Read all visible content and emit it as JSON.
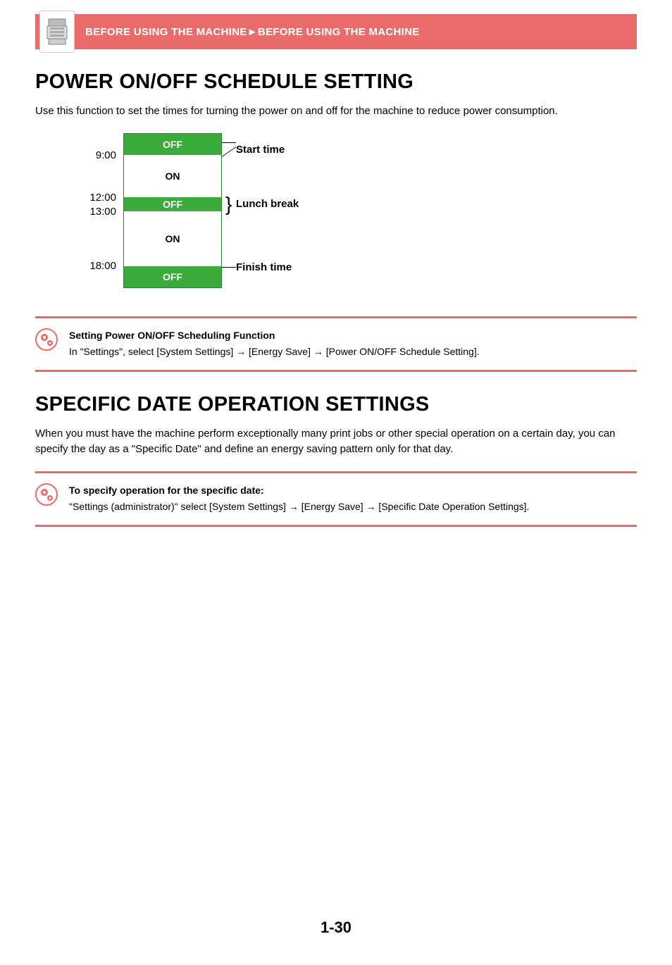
{
  "header": {
    "breadcrumb": "BEFORE USING THE MACHINE►BEFORE USING THE MACHINE"
  },
  "section1": {
    "title": "POWER ON/OFF SCHEDULE SETTING",
    "intro": "Use this function to set the times for turning the power on and off for the machine to reduce power consumption."
  },
  "diagram": {
    "times": {
      "t1": "9:00",
      "t2": "12:00",
      "t3": "13:00",
      "t4": "18:00"
    },
    "segs": {
      "off1": "OFF",
      "on1": "ON",
      "off2": "OFF",
      "on2": "ON",
      "off3": "OFF"
    },
    "labels": {
      "start": "Start time",
      "lunch": "Lunch break",
      "finish": "Finish time"
    }
  },
  "note1": {
    "title": "Setting Power ON/OFF Scheduling Function",
    "text": "In \"Settings\", select [System Settings] → [Energy Save] → [Power ON/OFF Schedule Setting]."
  },
  "section2": {
    "title": "SPECIFIC DATE OPERATION SETTINGS",
    "intro": "When you must have the machine perform exceptionally many print jobs or other special operation on a certain day, you can specify the day as a \"Specific Date\" and define an energy saving pattern only for that day."
  },
  "note2": {
    "title": "To specify operation for the specific date:",
    "text": "\"Settings  (administrator)\" select  [System Settings] → [Energy Save] → [Specific Date Operation Settings]."
  },
  "pageNumber": "1-30",
  "chart_data": {
    "type": "bar",
    "orientation": "vertical-timeline",
    "title": "Power ON/OFF Schedule",
    "segments": [
      {
        "state": "OFF",
        "until": "9:00",
        "label": "Start time"
      },
      {
        "state": "ON",
        "until": "12:00"
      },
      {
        "state": "OFF",
        "until": "13:00",
        "label": "Lunch break"
      },
      {
        "state": "ON",
        "until": "18:00"
      },
      {
        "state": "OFF",
        "until": null,
        "label": "Finish time"
      }
    ],
    "time_marks": [
      "9:00",
      "12:00",
      "13:00",
      "18:00"
    ]
  }
}
